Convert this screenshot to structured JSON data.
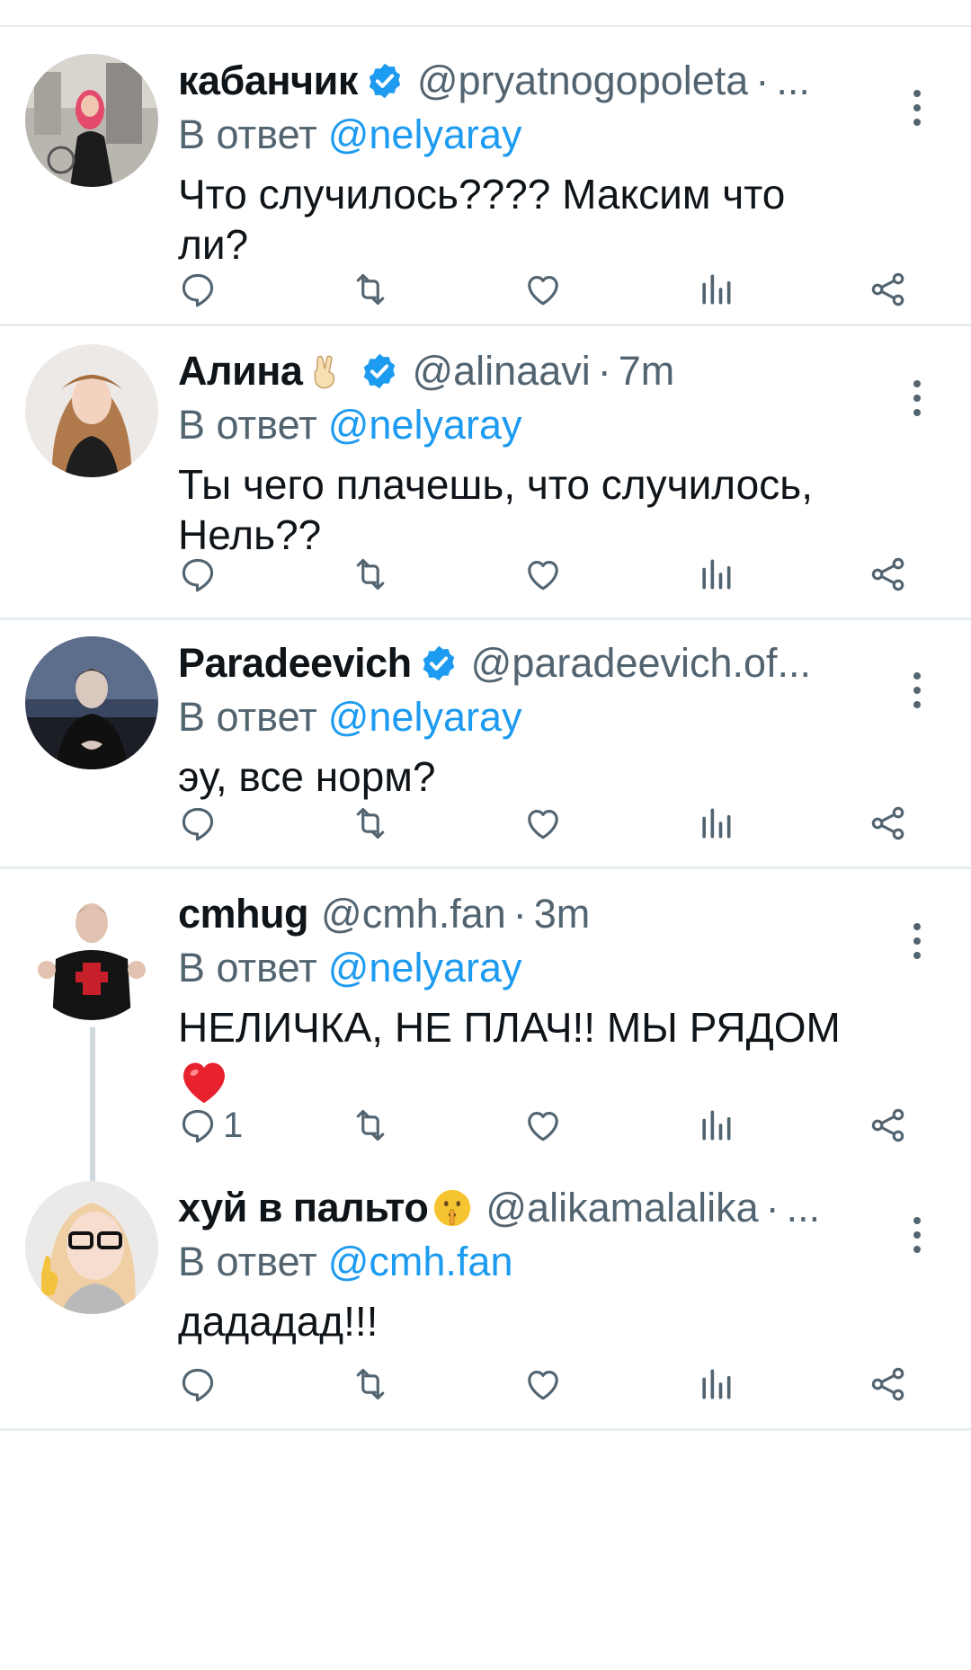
{
  "reply_prefix": "В ответ",
  "icons": [
    "reply-icon",
    "retweet-icon",
    "like-icon",
    "views-icon",
    "share-icon",
    "more-icon",
    "verified-badge-icon"
  ],
  "colors": {
    "accent": "#1d9bf0",
    "muted": "#536471",
    "divider": "#e6ecf0"
  },
  "tweets": [
    {
      "name": "кабанчик",
      "handle": "@pryatnogopoleta",
      "sep": "·",
      "time": "...",
      "mention": "@nelyaray",
      "text": "Что случилось???? Максим что ли?",
      "reply_count": ""
    },
    {
      "name": "Алина",
      "handle": "@alinaavi",
      "sep": "·",
      "time": "7m",
      "mention": "@nelyaray",
      "text": "Ты чего плачешь, что случилось, Нель??",
      "reply_count": ""
    },
    {
      "name": "Paradeevich",
      "handle": "@paradeevich.of...",
      "sep": "",
      "time": "",
      "mention": "@nelyaray",
      "text": "эу, все норм?",
      "reply_count": ""
    },
    {
      "name": "cmhug",
      "handle": "@cmh.fan",
      "sep": "·",
      "time": "3m",
      "mention": "@nelyaray",
      "text": "НЕЛИЧКА, НЕ ПЛАЧ!! МЫ РЯДОМ",
      "reply_count": "1"
    },
    {
      "name": "хуй в пальто",
      "handle": "@alikamalalika",
      "sep": "·",
      "time": "...",
      "mention": "@cmh.fan",
      "text": "дададад!!!",
      "reply_count": ""
    }
  ]
}
